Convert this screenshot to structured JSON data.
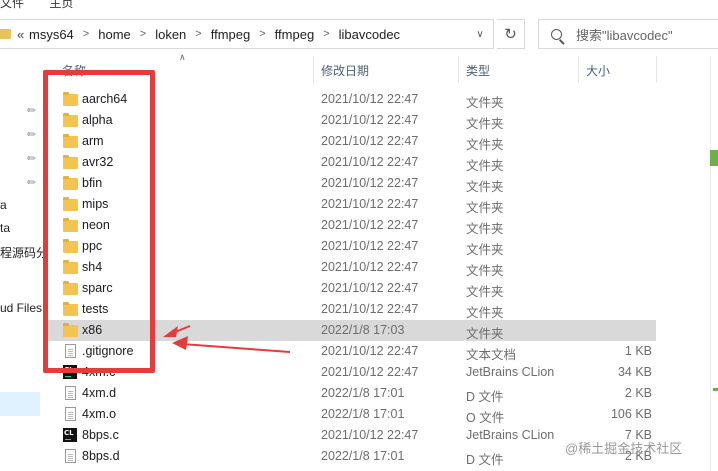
{
  "title_fragments": [
    "文件",
    "主页"
  ],
  "address": {
    "overflow": "«",
    "crumbs": [
      "msys64",
      "home",
      "loken",
      "ffmpeg",
      "ffmpeg",
      "libavcodec"
    ]
  },
  "search": {
    "placeholder": "搜索\"libavcodec\""
  },
  "nav": {
    "items": [
      {
        "label": "a"
      },
      {
        "label": "ta"
      },
      {
        "label": "程源码分"
      },
      {
        "label": "ud Files"
      }
    ]
  },
  "columns": {
    "name": "名称",
    "date": "修改日期",
    "type": "类型",
    "size": "大小"
  },
  "files": [
    {
      "name": "aarch64",
      "date": "2021/10/12 22:47",
      "type": "文件夹",
      "size": "",
      "icon": "folder"
    },
    {
      "name": "alpha",
      "date": "2021/10/12 22:47",
      "type": "文件夹",
      "size": "",
      "icon": "folder"
    },
    {
      "name": "arm",
      "date": "2021/10/12 22:47",
      "type": "文件夹",
      "size": "",
      "icon": "folder"
    },
    {
      "name": "avr32",
      "date": "2021/10/12 22:47",
      "type": "文件夹",
      "size": "",
      "icon": "folder"
    },
    {
      "name": "bfin",
      "date": "2021/10/12 22:47",
      "type": "文件夹",
      "size": "",
      "icon": "folder"
    },
    {
      "name": "mips",
      "date": "2021/10/12 22:47",
      "type": "文件夹",
      "size": "",
      "icon": "folder"
    },
    {
      "name": "neon",
      "date": "2021/10/12 22:47",
      "type": "文件夹",
      "size": "",
      "icon": "folder"
    },
    {
      "name": "ppc",
      "date": "2021/10/12 22:47",
      "type": "文件夹",
      "size": "",
      "icon": "folder"
    },
    {
      "name": "sh4",
      "date": "2021/10/12 22:47",
      "type": "文件夹",
      "size": "",
      "icon": "folder"
    },
    {
      "name": "sparc",
      "date": "2021/10/12 22:47",
      "type": "文件夹",
      "size": "",
      "icon": "folder"
    },
    {
      "name": "tests",
      "date": "2021/10/12 22:47",
      "type": "文件夹",
      "size": "",
      "icon": "folder"
    },
    {
      "name": "x86",
      "date": "2022/1/8 17:03",
      "type": "文件夹",
      "size": "",
      "icon": "folder",
      "selected": true
    },
    {
      "name": ".gitignore",
      "date": "2021/10/12 22:47",
      "type": "文本文档",
      "size": "1 KB",
      "icon": "doc"
    },
    {
      "name": "4xm.c",
      "date": "2021/10/12 22:47",
      "type": "JetBrains CLion",
      "size": "34 KB",
      "icon": "clion"
    },
    {
      "name": "4xm.d",
      "date": "2022/1/8 17:01",
      "type": "D 文件",
      "size": "2 KB",
      "icon": "doc"
    },
    {
      "name": "4xm.o",
      "date": "2022/1/8 17:01",
      "type": "O 文件",
      "size": "106 KB",
      "icon": "doc"
    },
    {
      "name": "8bps.c",
      "date": "2021/10/12 22:47",
      "type": "JetBrains CLion",
      "size": "7 KB",
      "icon": "clion"
    },
    {
      "name": "8bps.d",
      "date": "2022/1/8 17:01",
      "type": "D 文件",
      "size": "2 KB",
      "icon": "doc"
    }
  ],
  "watermark": "@稀土掘金技术社区",
  "colors": {
    "annotation": "#e53b3b",
    "folder": "#f3c44f",
    "selection": "#d9d9d9"
  }
}
